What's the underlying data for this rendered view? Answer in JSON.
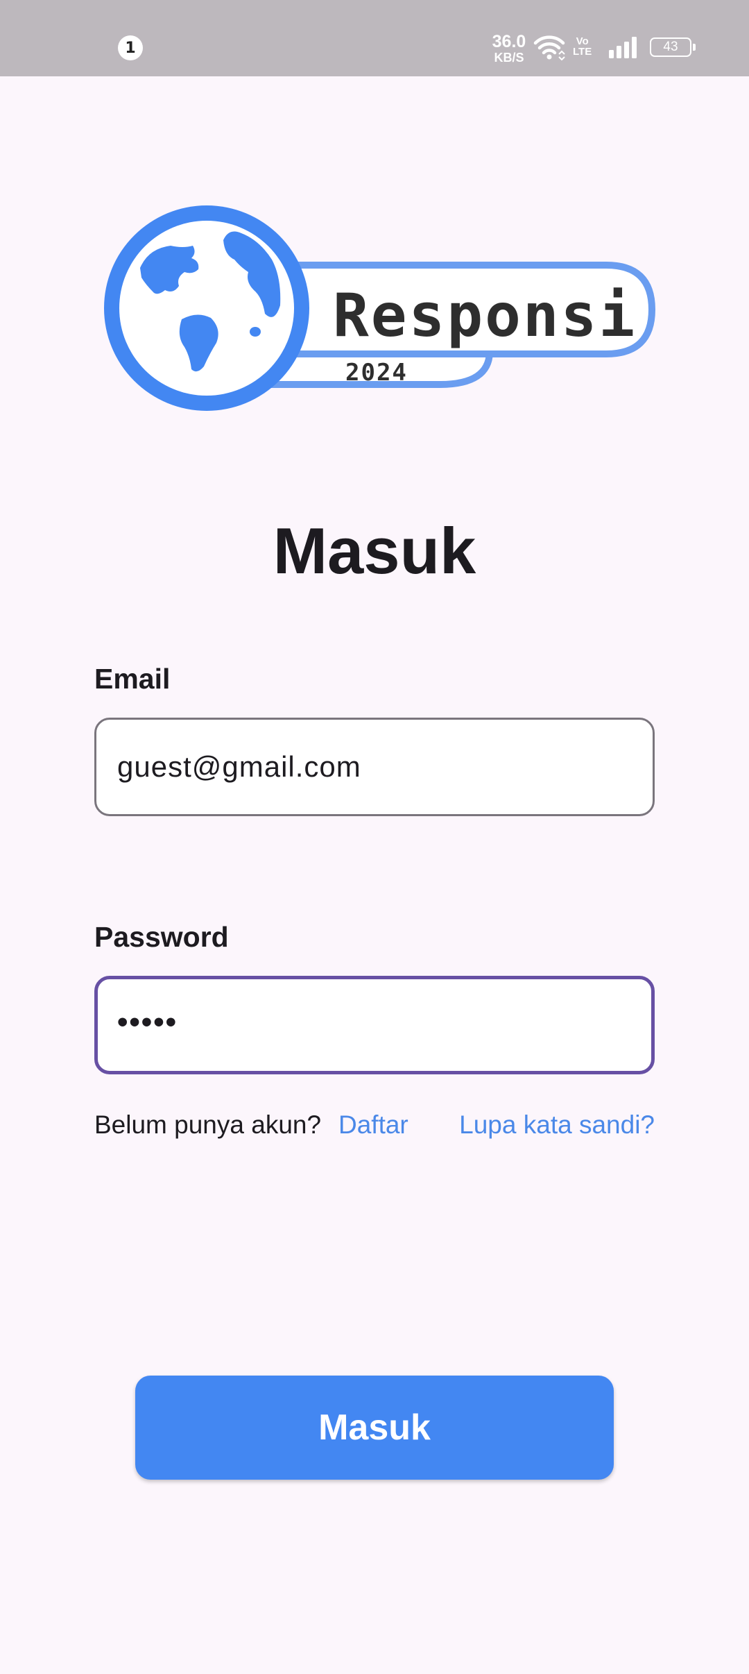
{
  "status_bar": {
    "notification_count": "1",
    "net_speed_value": "36.0",
    "net_speed_unit": "KB/S",
    "volte_label_top": "Vo",
    "volte_label_bottom": "LTE",
    "battery_level": "43",
    "icons": [
      "wifi-icon",
      "volte-icon",
      "signal-icon",
      "battery-icon"
    ]
  },
  "logo": {
    "title": "Responsi",
    "year": "2024",
    "icon": "globe-icon",
    "color": "#4387F2"
  },
  "login": {
    "heading": "Masuk",
    "email_label": "Email",
    "email_value": "guest@gmail.com",
    "password_label": "Password",
    "password_value": "•••••",
    "no_account_text": "Belum punya akun?",
    "register_link": "Daftar",
    "forgot_link": "Lupa kata sandi?",
    "submit_label": "Masuk"
  },
  "colors": {
    "background": "#FCF6FC",
    "status_bar": "#BDB8BD",
    "accent": "#4387F2",
    "link": "#4A88E8",
    "focus_border": "#6750A4"
  }
}
